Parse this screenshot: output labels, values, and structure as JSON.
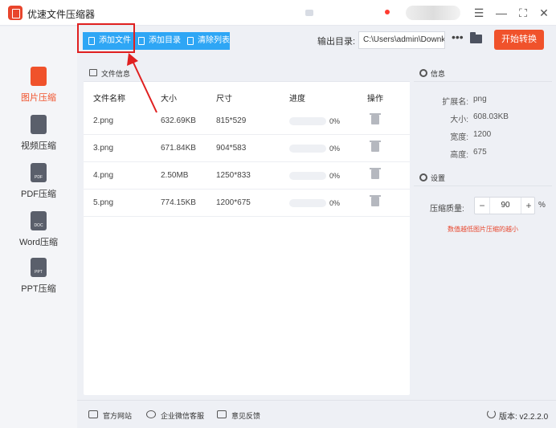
{
  "app": {
    "title": "优速文件压缩器"
  },
  "titlebar": {
    "menu_icon": "hamburger-icon",
    "minimize": "minimize-icon",
    "maximize": "maximize-icon",
    "close": "close-icon"
  },
  "sidebar": {
    "items": [
      {
        "label": "图片压缩",
        "icon": "image-file-icon",
        "icon_text": "",
        "active": true
      },
      {
        "label": "视频压缩",
        "icon": "video-file-icon",
        "icon_text": "",
        "active": false
      },
      {
        "label": "PDF压缩",
        "icon": "pdf-file-icon",
        "icon_text": "PDF",
        "active": false
      },
      {
        "label": "Word压缩",
        "icon": "word-file-icon",
        "icon_text": "DOC",
        "active": false
      },
      {
        "label": "PPT压缩",
        "icon": "ppt-file-icon",
        "icon_text": "PPT",
        "active": false
      }
    ]
  },
  "toolbar": {
    "add_file": "添加文件",
    "add_dir": "添加目录",
    "clear_list": "清除列表",
    "output_label": "输出目录:",
    "output_path": "C:\\Users\\admin\\Downk",
    "more": "•••",
    "start": "开始转换"
  },
  "file_panel": {
    "title": "文件信息",
    "columns": [
      "文件名称",
      "大小",
      "尺寸",
      "进度",
      "操作"
    ],
    "rows": [
      {
        "name": "2.png",
        "size": "632.69KB",
        "dims": "815*529",
        "progress": "0%"
      },
      {
        "name": "3.png",
        "size": "671.84KB",
        "dims": "904*583",
        "progress": "0%"
      },
      {
        "name": "4.png",
        "size": "2.50MB",
        "dims": "1250*833",
        "progress": "0%"
      },
      {
        "name": "5.png",
        "size": "774.15KB",
        "dims": "1200*675",
        "progress": "0%"
      }
    ]
  },
  "info": {
    "title": "信息",
    "fields": [
      {
        "label": "扩展名:",
        "value": "png"
      },
      {
        "label": "大小:",
        "value": "608.03KB"
      },
      {
        "label": "宽度:",
        "value": "1200"
      },
      {
        "label": "高度:",
        "value": "675"
      }
    ]
  },
  "settings": {
    "title": "设置",
    "quality_label": "压缩质量:",
    "minus": "−",
    "quality_value": "90",
    "plus": "+",
    "unit": "%",
    "hint": "数值越低图片压缩的越小"
  },
  "footer": {
    "website": "官方网站",
    "wechat": "企业微信客服",
    "feedback": "意见反馈",
    "version": "版本: v2.2.2.0"
  },
  "colors": {
    "accent": "#f0522b",
    "blue": "#2ea6f5",
    "annotation": "#e02020"
  }
}
